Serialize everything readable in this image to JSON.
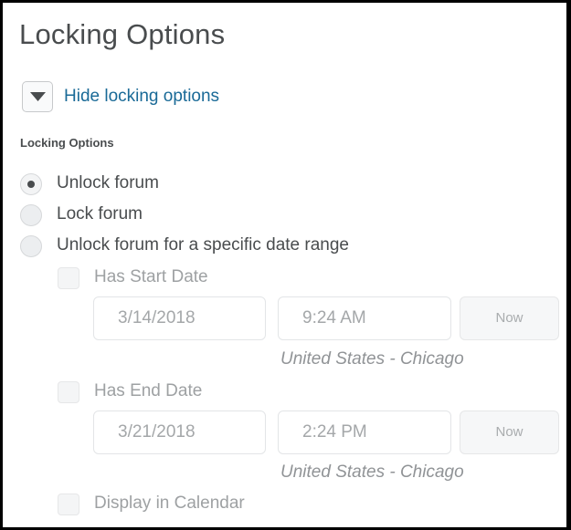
{
  "title": "Locking Options",
  "toggle": {
    "label": "Hide locking options",
    "icon": "caret-down-icon"
  },
  "section_label": "Locking Options",
  "radios": [
    {
      "label": "Unlock forum",
      "checked": true
    },
    {
      "label": "Lock forum",
      "checked": false
    },
    {
      "label": "Unlock forum for a specific date range",
      "checked": false
    }
  ],
  "start": {
    "label": "Has Start Date",
    "date": "3/14/2018",
    "time": "9:24 AM",
    "now_label": "Now",
    "timezone": "United States - Chicago"
  },
  "end": {
    "label": "Has End Date",
    "date": "3/21/2018",
    "time": "2:24 PM",
    "now_label": "Now",
    "timezone": "United States - Chicago"
  },
  "calendar": {
    "label": "Display in Calendar"
  },
  "colors": {
    "text": "#494c4e",
    "link": "#1a6a97",
    "disabled_text": "#9ea1a3"
  }
}
